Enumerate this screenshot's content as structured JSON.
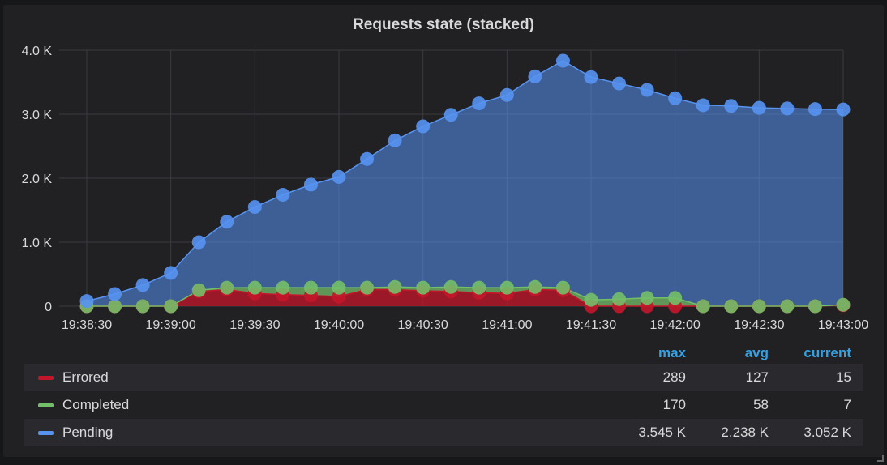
{
  "panel": {
    "title": "Requests state (stacked)"
  },
  "legend": {
    "headers": {
      "max": "max",
      "avg": "avg",
      "current": "current"
    },
    "rows": [
      {
        "name": "Errored",
        "color": "#c4162a",
        "max": "289",
        "avg": "127",
        "current": "15"
      },
      {
        "name": "Completed",
        "color": "#73bf69",
        "max": "170",
        "avg": "58",
        "current": "7"
      },
      {
        "name": "Pending",
        "color": "#5794f2",
        "max": "3.545 K",
        "avg": "2.238 K",
        "current": "3.052 K"
      }
    ]
  },
  "chart_data": {
    "type": "area",
    "stacked": true,
    "title": "Requests state (stacked)",
    "y_ticks": [
      "0",
      "1.0 K",
      "2.0 K",
      "3.0 K",
      "4.0 K"
    ],
    "ylim": [
      0,
      4000
    ],
    "x_ticks": [
      "19:38:30",
      "19:39:00",
      "19:39:30",
      "19:40:00",
      "19:40:30",
      "19:41:00",
      "19:41:30",
      "19:42:00",
      "19:42:30",
      "19:43:00"
    ],
    "x": [
      "19:38:30",
      "19:38:40",
      "19:38:50",
      "19:39:00",
      "19:39:10",
      "19:39:20",
      "19:39:30",
      "19:39:40",
      "19:39:50",
      "19:40:00",
      "19:40:10",
      "19:40:20",
      "19:40:30",
      "19:40:40",
      "19:40:50",
      "19:41:00",
      "19:41:10",
      "19:41:20",
      "19:41:30",
      "19:41:40",
      "19:41:50",
      "19:42:00",
      "19:42:10",
      "19:42:20",
      "19:42:30",
      "19:42:40",
      "19:42:50",
      "19:43:00"
    ],
    "grid": true,
    "legend_position": "bottom",
    "series": [
      {
        "name": "Errored",
        "color": "#c4162a",
        "values": [
          0,
          0,
          0,
          0,
          230,
          260,
          200,
          180,
          170,
          150,
          260,
          260,
          240,
          230,
          210,
          200,
          260,
          250,
          0,
          0,
          0,
          0,
          0,
          0,
          0,
          0,
          0,
          15
        ]
      },
      {
        "name": "Completed",
        "color": "#73bf69",
        "values": [
          0,
          0,
          0,
          0,
          20,
          30,
          90,
          110,
          120,
          140,
          30,
          40,
          50,
          70,
          80,
          90,
          40,
          40,
          100,
          110,
          130,
          130,
          0,
          0,
          0,
          0,
          0,
          7
        ]
      },
      {
        "name": "Pending",
        "color": "#5794f2",
        "values": [
          80,
          190,
          330,
          520,
          750,
          1030,
          1260,
          1450,
          1610,
          1730,
          2010,
          2290,
          2520,
          2690,
          2880,
          3010,
          3290,
          3545,
          3480,
          3370,
          3250,
          3120,
          3140,
          3130,
          3100,
          3090,
          3080,
          3052
        ]
      }
    ]
  }
}
